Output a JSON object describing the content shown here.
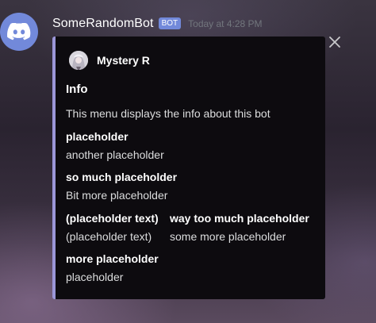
{
  "message": {
    "username": "SomeRandomBot",
    "bot_tag": "BOT",
    "timestamp": "Today at 4:28 PM",
    "avatar_icon": "discord-logo-icon",
    "accent_color": "#7289da"
  },
  "embed": {
    "color": "#9b96d8",
    "author": {
      "name": "Mystery R",
      "icon": "author-avatar-icon"
    },
    "title": "Info",
    "description": "This menu displays the info about this bot",
    "fields": [
      {
        "name": "placeholder",
        "value": "another placeholder",
        "inline": false
      },
      {
        "name": "so much placeholder",
        "value": "Bit more placeholder",
        "inline": false
      },
      {
        "name": "(placeholder text)",
        "value": "(placeholder text)",
        "inline": true
      },
      {
        "name": "way too much placeholder",
        "value": "some more placeholder",
        "inline": true
      },
      {
        "name": "more placeholder",
        "value": "placeholder",
        "inline": false
      }
    ]
  },
  "controls": {
    "close_icon": "close-icon"
  }
}
